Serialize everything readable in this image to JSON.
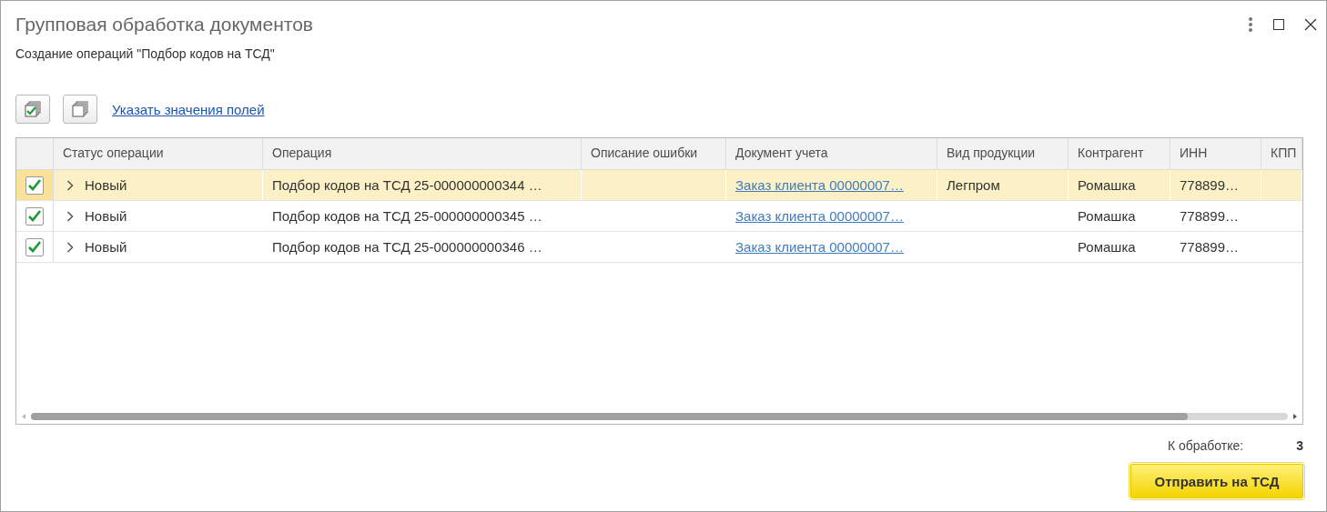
{
  "window": {
    "title": "Групповая обработка документов"
  },
  "subtitle": "Создание операций \"Подбор кодов на ТСД\"",
  "toolbar": {
    "link": "Указать значения полей"
  },
  "table": {
    "columns": [
      "Статус операции",
      "Операция",
      "Описание ошибки",
      "Документ учета",
      "Вид продукции",
      "Контрагент",
      "ИНН",
      "КПП"
    ],
    "rows": [
      {
        "selected": true,
        "checked": true,
        "status": "Новый",
        "operation": "Подбор кодов на ТСД 25-000000000344 …",
        "error": "",
        "document": "Заказ клиента 00000007…",
        "product": "Легпром",
        "counterparty": "Ромашка",
        "inn": "778899…",
        "kpp": ""
      },
      {
        "selected": false,
        "checked": true,
        "status": "Новый",
        "operation": "Подбор кодов на ТСД 25-000000000345 …",
        "error": "",
        "document": "Заказ клиента 00000007…",
        "product": "",
        "counterparty": "Ромашка",
        "inn": "778899…",
        "kpp": ""
      },
      {
        "selected": false,
        "checked": true,
        "status": "Новый",
        "operation": "Подбор кодов на ТСД 25-000000000346 …",
        "error": "",
        "document": "Заказ клиента 00000007…",
        "product": "",
        "counterparty": "Ромашка",
        "inn": "778899…",
        "kpp": ""
      }
    ]
  },
  "footer": {
    "label": "К обработке:",
    "count": "3",
    "button": "Отправить на ТСД"
  }
}
